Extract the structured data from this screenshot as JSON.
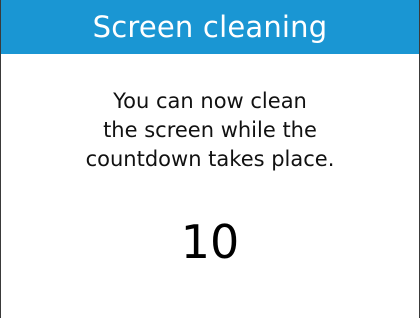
{
  "title_bar": {
    "title": "Screen cleaning",
    "color": "#1a96d3"
  },
  "message": {
    "lines": [
      "You can now clean",
      "the screen while the",
      "countdown takes place."
    ]
  },
  "countdown": {
    "value": "10"
  }
}
